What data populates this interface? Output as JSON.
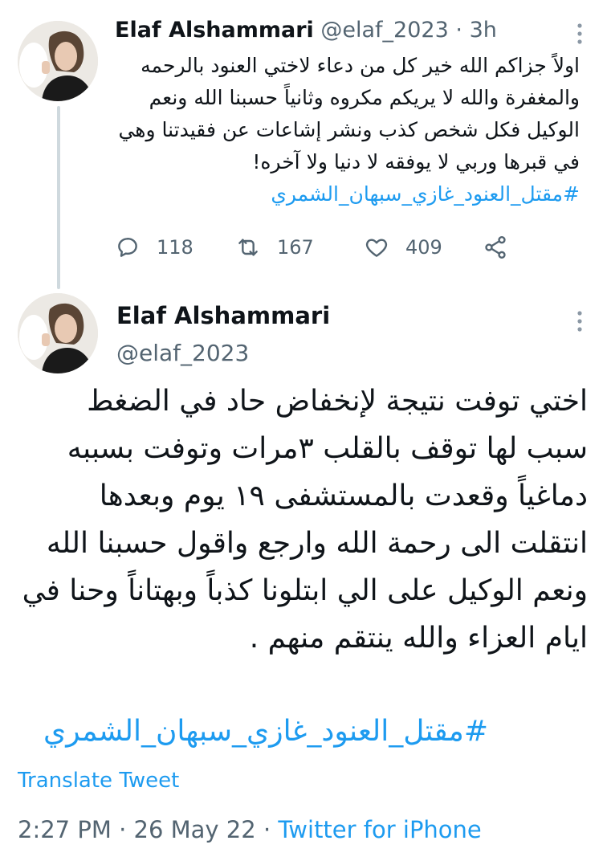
{
  "tweet1": {
    "name": "Elaf Alshammari",
    "handle": "@elaf_2023",
    "time": "3h",
    "separator": "·",
    "body": "اولاً جزاكم الله خير كل من دعاء لاختي العنود بالرحمه والمغفرة والله لا يريكم مكروه وثانياً حسبنا الله ونعم الوكيل فكل شخص كذب ونشر إشاعات عن فقيدتنا وهي في قبرها وربي لا يوفقه لا دنيا ولا آخره!",
    "hashtag": "#مقتل_العنود_غازي_سبهان_الشمري",
    "replies": "118",
    "retweets": "167",
    "likes": "409"
  },
  "tweet2": {
    "name": "Elaf Alshammari",
    "handle": "@elaf_2023",
    "body": "اختي توفت نتيجة لإنخفاض حاد في الضغط سبب لها توقف بالقلب ٣مرات وتوفت بسببه دماغياً وقعدت بالمستشفى ١٩ يوم وبعدها انتقلت الى رحمة الله وارجع واقول حسبنا الله ونعم الوكيل على الي ابتلونا كذباً وبهتاناً وحنا في ايام العزاء والله ينتقم منهم .",
    "hashtag": "#مقتل_العنود_غازي_سبهان_الشمري",
    "translate_label": "Translate Tweet",
    "time": "2:27 PM",
    "date": "26 May 22",
    "source": "Twitter for iPhone",
    "separator": "·"
  },
  "icons": {
    "reply": "reply-icon",
    "retweet": "retweet-icon",
    "like": "heart-icon",
    "share": "share-icon",
    "more": "more-vertical-icon"
  },
  "colors": {
    "link": "#1d9bf0",
    "muted": "#536471",
    "text": "#0f1419",
    "thread_line": "#cfd9de"
  }
}
